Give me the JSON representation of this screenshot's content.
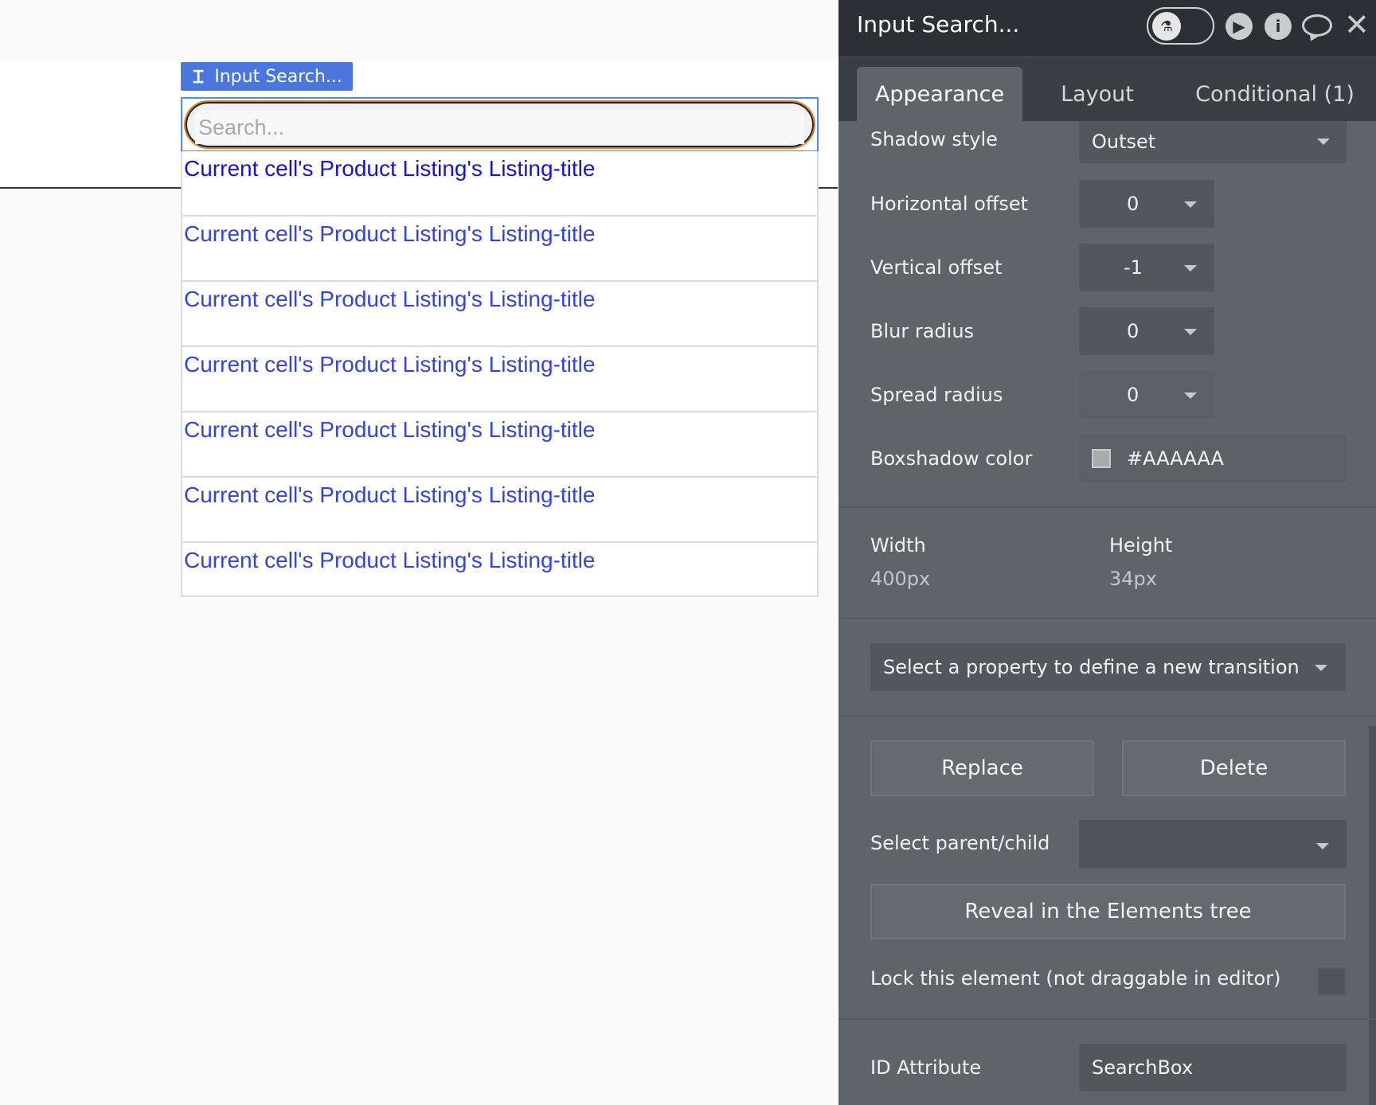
{
  "canvas": {
    "element_tag": "Input Search...",
    "search_placeholder": "Search...",
    "rows": [
      "Current cell's Product Listing's Listing-title",
      "Current cell's Product Listing's Listing-title",
      "Current cell's Product Listing's Listing-title",
      "Current cell's Product Listing's Listing-title",
      "Current cell's Product Listing's Listing-title",
      "Current cell's Product Listing's Listing-title",
      "Current cell's Product Listing's Listing-title"
    ]
  },
  "panel": {
    "title": "Input Search...",
    "tabs": [
      "Appearance",
      "Layout",
      "Conditional (1)"
    ],
    "active_tab": "Appearance",
    "shadow_style": {
      "label": "Shadow style",
      "value": "Outset"
    },
    "horizontal_offset": {
      "label": "Horizontal offset",
      "value": "0"
    },
    "vertical_offset": {
      "label": "Vertical offset",
      "value": "-1"
    },
    "blur_radius": {
      "label": "Blur radius",
      "value": "0"
    },
    "spread_radius": {
      "label": "Spread radius",
      "value": "0"
    },
    "boxshadow_color": {
      "label": "Boxshadow color",
      "value": "#AAAAAA"
    },
    "width": {
      "label": "Width",
      "value": "400px"
    },
    "height": {
      "label": "Height",
      "value": "34px"
    },
    "transition_placeholder": "Select a property to define a new transition",
    "replace_label": "Replace",
    "delete_label": "Delete",
    "parent_child_label": "Select parent/child",
    "parent_child_value": "",
    "reveal_label": "Reveal in the Elements tree",
    "lock_label": "Lock this element (not draggable in editor)",
    "lock_checked": false,
    "id_attribute": {
      "label": "ID Attribute",
      "value": "SearchBox"
    }
  },
  "colors": {
    "panel_bg": "#5f6468",
    "header_bg": "#2c3034",
    "element_tag_bg": "#4a76dd",
    "link_color": "#3344dd",
    "swatch": "#aaaaaa"
  },
  "icons": [
    "text-cursor-icon",
    "flask-icon",
    "play-icon",
    "info-icon",
    "chat-icon",
    "close-icon",
    "chevron-down-icon"
  ]
}
